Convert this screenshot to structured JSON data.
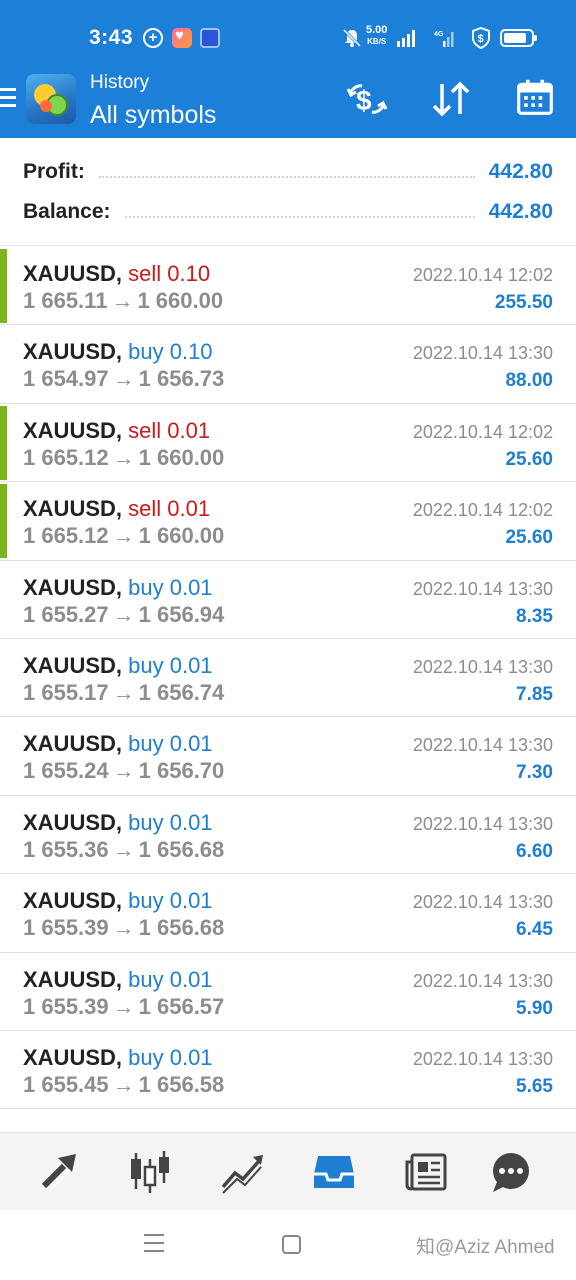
{
  "status_bar": {
    "time": "3:43",
    "net_speed_value": "5.00",
    "net_speed_unit": "KB/S",
    "sig2_label": "4G"
  },
  "app_bar": {
    "subtitle": "History",
    "title": "All symbols"
  },
  "summary": {
    "profit_label": "Profit:",
    "profit_value": "442.80",
    "balance_label": "Balance:",
    "balance_value": "442.80"
  },
  "trades": [
    {
      "symbol": "XAUUSD,",
      "side": "sell",
      "volume": "0.10",
      "open": "1 665.11",
      "close": "1 660.00",
      "time": "2022.10.14 12:02",
      "profit": "255.50",
      "marked": true
    },
    {
      "symbol": "XAUUSD,",
      "side": "buy",
      "volume": "0.10",
      "open": "1 654.97",
      "close": "1 656.73",
      "time": "2022.10.14 13:30",
      "profit": "88.00",
      "marked": false
    },
    {
      "symbol": "XAUUSD,",
      "side": "sell",
      "volume": "0.01",
      "open": "1 665.12",
      "close": "1 660.00",
      "time": "2022.10.14 12:02",
      "profit": "25.60",
      "marked": true
    },
    {
      "symbol": "XAUUSD,",
      "side": "sell",
      "volume": "0.01",
      "open": "1 665.12",
      "close": "1 660.00",
      "time": "2022.10.14 12:02",
      "profit": "25.60",
      "marked": true
    },
    {
      "symbol": "XAUUSD,",
      "side": "buy",
      "volume": "0.01",
      "open": "1 655.27",
      "close": "1 656.94",
      "time": "2022.10.14 13:30",
      "profit": "8.35",
      "marked": false
    },
    {
      "symbol": "XAUUSD,",
      "side": "buy",
      "volume": "0.01",
      "open": "1 655.17",
      "close": "1 656.74",
      "time": "2022.10.14 13:30",
      "profit": "7.85",
      "marked": false
    },
    {
      "symbol": "XAUUSD,",
      "side": "buy",
      "volume": "0.01",
      "open": "1 655.24",
      "close": "1 656.70",
      "time": "2022.10.14 13:30",
      "profit": "7.30",
      "marked": false
    },
    {
      "symbol": "XAUUSD,",
      "side": "buy",
      "volume": "0.01",
      "open": "1 655.36",
      "close": "1 656.68",
      "time": "2022.10.14 13:30",
      "profit": "6.60",
      "marked": false
    },
    {
      "symbol": "XAUUSD,",
      "side": "buy",
      "volume": "0.01",
      "open": "1 655.39",
      "close": "1 656.68",
      "time": "2022.10.14 13:30",
      "profit": "6.45",
      "marked": false
    },
    {
      "symbol": "XAUUSD,",
      "side": "buy",
      "volume": "0.01",
      "open": "1 655.39",
      "close": "1 656.57",
      "time": "2022.10.14 13:30",
      "profit": "5.90",
      "marked": false
    },
    {
      "symbol": "XAUUSD,",
      "side": "buy",
      "volume": "0.01",
      "open": "1 655.45",
      "close": "1 656.58",
      "time": "2022.10.14 13:30",
      "profit": "5.65",
      "marked": false
    }
  ],
  "arrow_glyph": "→",
  "bottom_nav": [
    "trade-icon",
    "chart-icon",
    "analytics-icon",
    "history-icon",
    "news-icon",
    "chat-icon"
  ],
  "watermark": "知@Aziz Ahmed",
  "colors": {
    "header": "#1c7fd8",
    "sell": "#cc1a1a",
    "buy": "#1e7fd2",
    "profit": "#1e7fd2",
    "marker": "#7ab51d"
  }
}
